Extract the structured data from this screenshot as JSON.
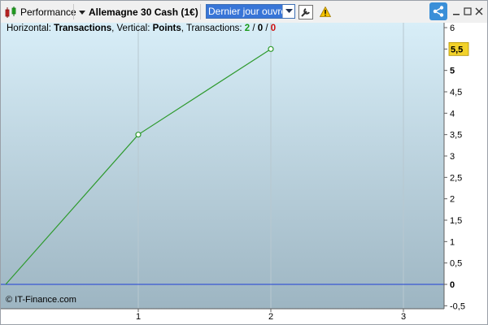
{
  "toolbar": {
    "performance_label": "Performance",
    "instrument_label": "Allemagne 30 Cash (1€)",
    "period_selected": "Dernier jour ouvré"
  },
  "info": {
    "horizontal_prefix": "Horizontal: ",
    "horizontal_value": "Transactions",
    "vertical_prefix": ", Vertical: ",
    "vertical_value": "Points",
    "transactions_prefix": ", Transactions: ",
    "count_won": "2",
    "slash1": " / ",
    "count_neutral": "0",
    "slash2": " / ",
    "count_lost": "0"
  },
  "current_value_label": "5,5",
  "copyright": "© IT-Finance.com",
  "colors": {
    "line": "#2e9a2e",
    "zero_line": "#1f3fd6",
    "value_badge": "#f2d22a",
    "won": "#1a9a1a",
    "lost": "#d01010",
    "bg_top": "#d8eef8",
    "bg_bottom": "#9db5c2"
  },
  "chart_data": {
    "type": "line",
    "x": [
      0,
      1,
      2
    ],
    "y": [
      0,
      3.5,
      5.5
    ],
    "x_ticks": [
      "1",
      "2",
      "3"
    ],
    "x_tick_values": [
      1,
      2,
      3
    ],
    "y_ticks": [
      "6",
      "5,5",
      "5",
      "4,5",
      "4",
      "3,5",
      "3",
      "2,5",
      "2",
      "1,5",
      "1",
      "0,5",
      "0",
      "-0,5"
    ],
    "y_tick_values": [
      6,
      5.5,
      5,
      4.5,
      4,
      3.5,
      3,
      2.5,
      2,
      1.5,
      1,
      0.5,
      0,
      -0.5
    ],
    "xlim": [
      0,
      3.3
    ],
    "ylim": [
      -0.5,
      6
    ],
    "grid": true,
    "xlabel": "",
    "ylabel": ""
  }
}
